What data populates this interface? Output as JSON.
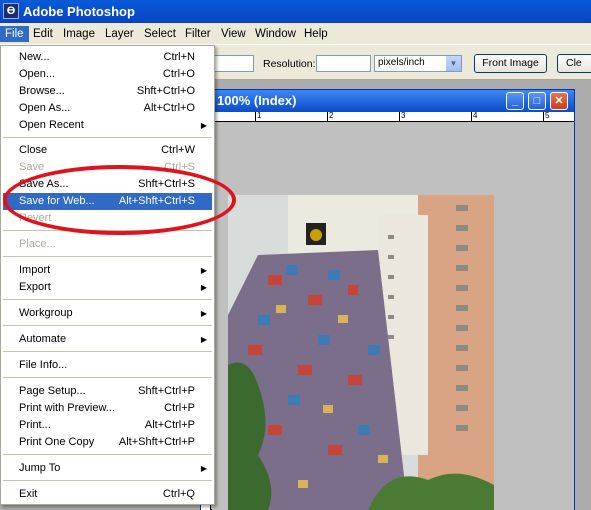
{
  "app": {
    "title": "Adobe Photoshop",
    "icon": "photoshop-app-icon"
  },
  "menubar": [
    "File",
    "Edit",
    "Image",
    "Layer",
    "Select",
    "Filter",
    "View",
    "Window",
    "Help"
  ],
  "options": {
    "resolution_label": "Resolution:",
    "units": "pixels/inch",
    "front_image": "Front Image",
    "clear_partial": "Cle"
  },
  "document": {
    "title": "100% (Index)",
    "ruler_marks": [
      "1",
      "2",
      "3",
      "4",
      "5"
    ]
  },
  "file_menu": {
    "items": [
      {
        "label": "New...",
        "shortcut": "Ctrl+N"
      },
      {
        "label": "Open...",
        "shortcut": "Ctrl+O"
      },
      {
        "label": "Browse...",
        "shortcut": "Shft+Ctrl+O"
      },
      {
        "label": "Open As...",
        "shortcut": "Alt+Ctrl+O"
      },
      {
        "label": "Open Recent",
        "submenu": true
      },
      {
        "label": "Close",
        "shortcut": "Ctrl+W"
      },
      {
        "label": "Save",
        "shortcut": "Ctrl+S",
        "disabled": true
      },
      {
        "label": "Save As...",
        "shortcut": "Shft+Ctrl+S"
      },
      {
        "label": "Save for Web...",
        "shortcut": "Alt+Shft+Ctrl+S",
        "selected": true
      },
      {
        "label": "Revert",
        "disabled": true
      },
      {
        "label": "Place...",
        "disabled": true
      },
      {
        "label": "Import",
        "submenu": true
      },
      {
        "label": "Export",
        "submenu": true
      },
      {
        "label": "Workgroup",
        "submenu": true
      },
      {
        "label": "Automate",
        "submenu": true
      },
      {
        "label": "File Info..."
      },
      {
        "label": "Page Setup...",
        "shortcut": "Shft+Ctrl+P"
      },
      {
        "label": "Print with Preview...",
        "shortcut": "Ctrl+P"
      },
      {
        "label": "Print...",
        "shortcut": "Alt+Ctrl+P"
      },
      {
        "label": "Print One Copy",
        "shortcut": "Alt+Shft+Ctrl+P"
      },
      {
        "label": "Jump To",
        "submenu": true
      },
      {
        "label": "Exit",
        "shortcut": "Ctrl+Q"
      }
    ]
  },
  "annotation": {
    "color": "#e0131c"
  }
}
